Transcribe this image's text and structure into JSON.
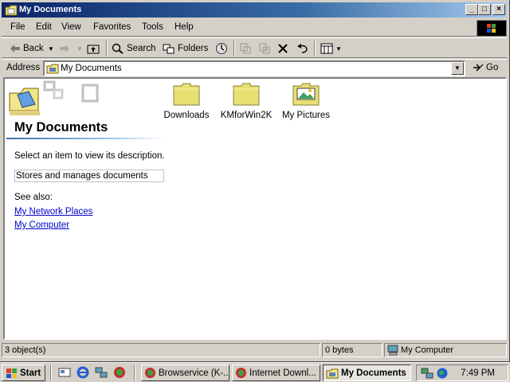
{
  "window": {
    "title": "My Documents"
  },
  "menu": {
    "items": [
      "File",
      "Edit",
      "View",
      "Favorites",
      "Tools",
      "Help"
    ]
  },
  "toolbar": {
    "back": "Back",
    "search": "Search",
    "folders": "Folders"
  },
  "address": {
    "label": "Address",
    "value": "My Documents",
    "go": "Go"
  },
  "panel": {
    "title": "My Documents",
    "select_hint": "Select an item to view its description.",
    "description": "Stores and manages documents",
    "see_also": "See also:",
    "links": [
      "My Network Places",
      "My Computer"
    ]
  },
  "files": [
    {
      "name": "Downloads",
      "icon": "folder-icon"
    },
    {
      "name": "KMforWin2K",
      "icon": "folder-icon"
    },
    {
      "name": "My Pictures",
      "icon": "pictures-folder-icon"
    }
  ],
  "status": {
    "objects": "3 object(s)",
    "size": "0 bytes",
    "zone": "My Computer"
  },
  "taskbar": {
    "start": "Start",
    "tasks": [
      {
        "label": "Browservice (K-..."
      },
      {
        "label": "Internet Downl..."
      },
      {
        "label": "My Documents"
      }
    ],
    "clock": "7:49 PM"
  },
  "colors": {
    "title_start": "#0a246a",
    "title_end": "#a6caf0",
    "link": "#0000cc",
    "folder": "#e8e070"
  }
}
